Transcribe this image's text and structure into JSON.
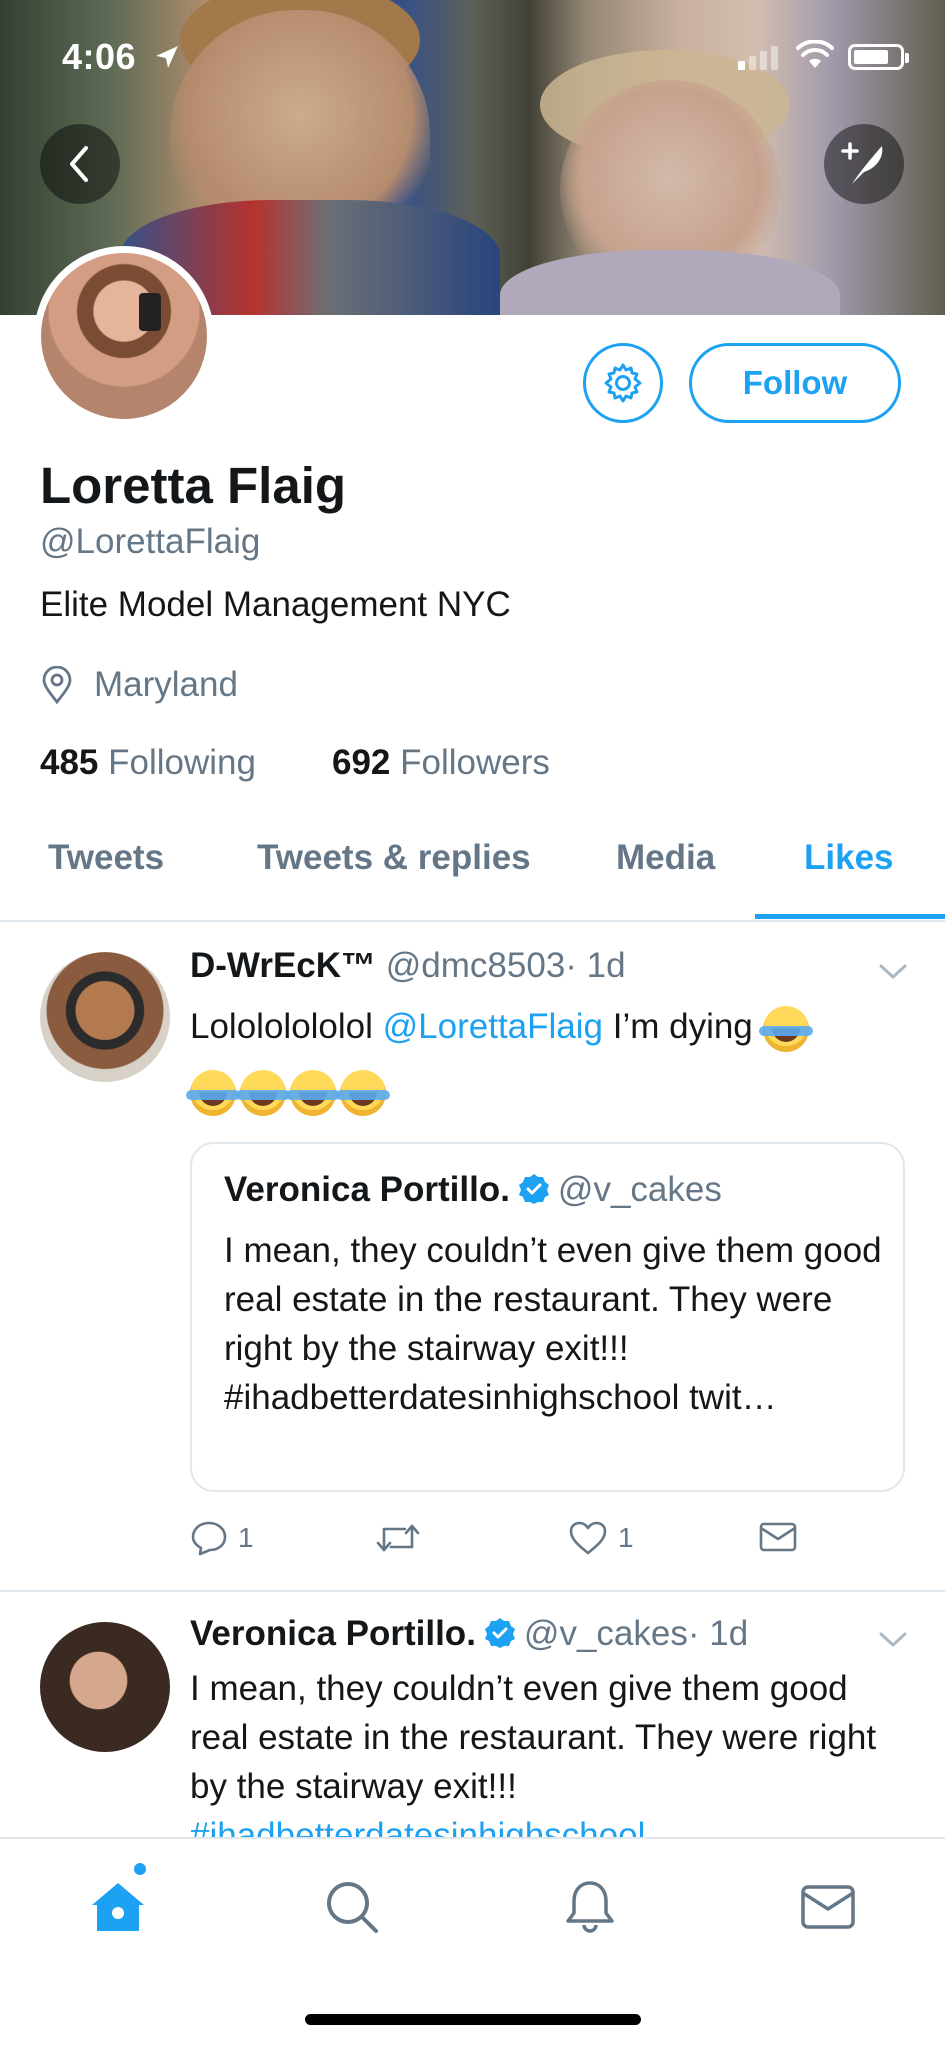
{
  "status_bar": {
    "time": "4:06"
  },
  "profile": {
    "name": "Loretta Flaig",
    "handle": "@LorettaFlaig",
    "bio": "Elite Model Management NYC",
    "location": "Maryland",
    "following_count": "485",
    "following_label": "Following",
    "followers_count": "692",
    "followers_label": "Followers",
    "follow_label": "Follow"
  },
  "tabs": [
    {
      "label": "Tweets"
    },
    {
      "label": "Tweets & replies"
    },
    {
      "label": "Media"
    },
    {
      "label": "Likes",
      "active": true
    }
  ],
  "tweets": [
    {
      "display_name": "D-WrEcK™",
      "handle": "@dmc8503",
      "time": "· 1d",
      "text_before": "Lolololololol ",
      "mention": "@LorettaFlaig",
      "text_after": " I’m dying",
      "emoji": "face-with-tears-of-joy",
      "quote": {
        "display_name": "Veronica Portillo.",
        "handle": "@v_cakes",
        "text": "I mean, they couldn’t even give them good real estate in the restaurant.  They were right by the stairway exit!!! #ihadbetterdatesinhighschool twit…"
      },
      "reply_count": "1",
      "like_count": "1"
    },
    {
      "display_name": "Veronica Portillo.",
      "handle": "@v_cakes",
      "time": "· 1d",
      "text": "I mean, they couldn’t even give them good real estate in the restaurant.  They were right by the stairway exit!!!",
      "hashtag": "#ihadbetterdatesinhighschool"
    }
  ],
  "colors": {
    "accent": "#1da1f2",
    "secondary_text": "#657786",
    "primary_text": "#14171a",
    "border": "#e1e8ed"
  },
  "icons": {
    "back": "chevron-left-icon",
    "compose": "compose-tweet-icon",
    "settings": "gear-icon",
    "location": "location-pin-icon",
    "nav": [
      "home-icon",
      "search-icon",
      "notifications-bell-icon",
      "messages-envelope-icon"
    ]
  }
}
